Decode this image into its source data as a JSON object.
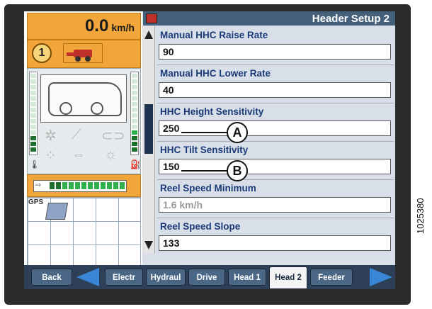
{
  "speed": {
    "value": "0.0",
    "unit": "km/h"
  },
  "status": {
    "gear_number": "1"
  },
  "map_grid": {
    "gps_label": "GPS"
  },
  "header_setup": {
    "title": "Header Setup 2",
    "settings": [
      {
        "label": "Manual HHC Raise Rate",
        "value": "90"
      },
      {
        "label": "Manual HHC Lower Rate",
        "value": "40"
      },
      {
        "label": "HHC Height Sensitivity",
        "value": "250",
        "callout": "A"
      },
      {
        "label": "HHC Tilt Sensitivity",
        "value": "150",
        "callout": "B"
      },
      {
        "label": "Reel Speed Minimum",
        "value": "1.6  km/h"
      },
      {
        "label": "Reel Speed Slope",
        "value": "133"
      }
    ]
  },
  "nav": {
    "back": "Back",
    "tabs": [
      "Electr",
      "Hydraul",
      "Drive",
      "Head 1",
      "Head 2",
      "Feeder"
    ],
    "active_tab": "Head 2"
  },
  "figure_code": "1025380",
  "colors": {
    "accent_orange": "#f2a53a",
    "title_bar": "#44607a",
    "label_blue": "#1a3a78",
    "nav_bg": "#2e3f58",
    "arrow_blue": "#3a86d6"
  }
}
